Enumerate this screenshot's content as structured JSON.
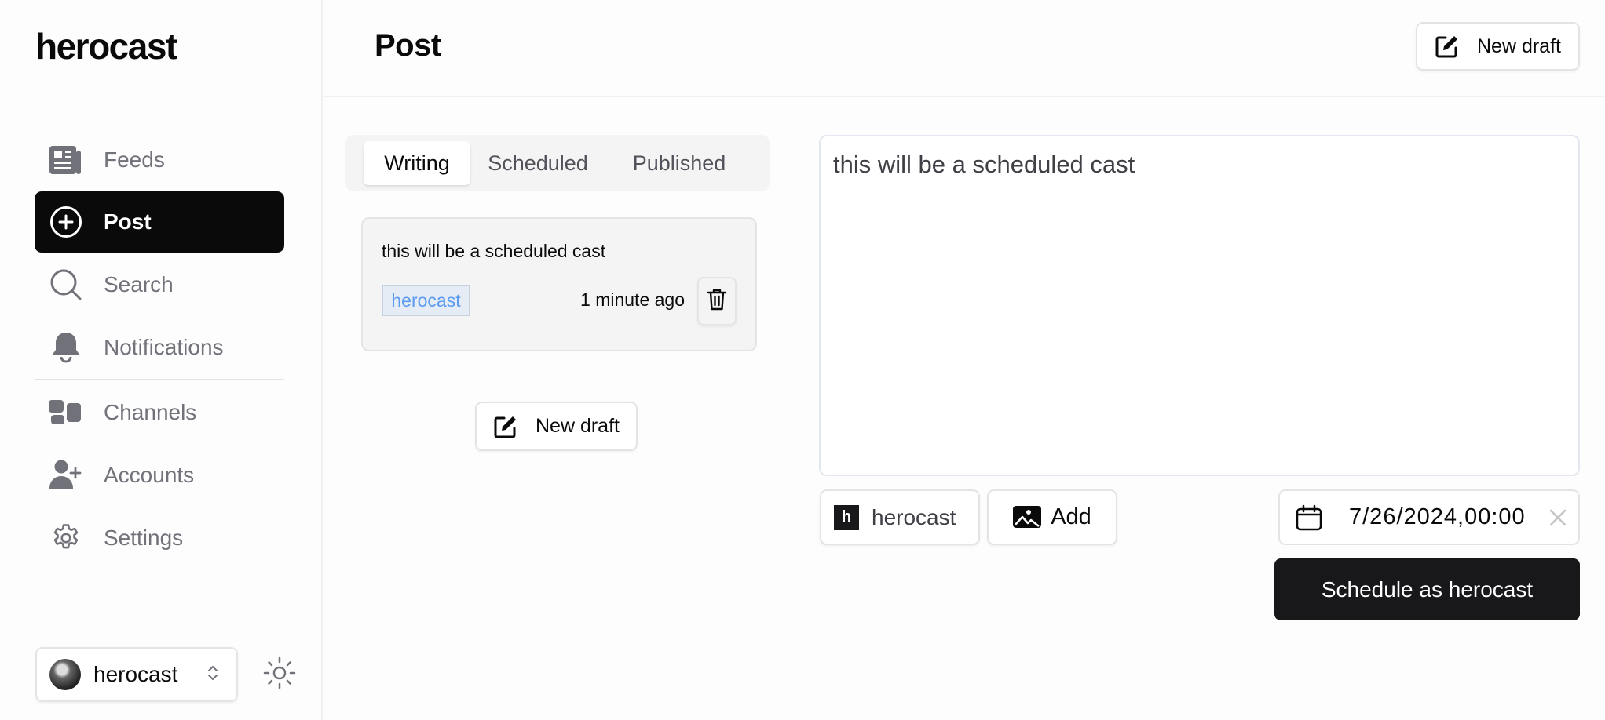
{
  "app": {
    "logo": "herocast"
  },
  "sidebar": {
    "items": [
      {
        "label": "Feeds",
        "icon": "newspaper-icon",
        "active": false
      },
      {
        "label": "Post",
        "icon": "plus-circle-icon",
        "active": true
      },
      {
        "label": "Search",
        "icon": "search-icon",
        "active": false
      },
      {
        "label": "Notifications",
        "icon": "bell-icon",
        "active": false
      },
      {
        "label": "Channels",
        "icon": "channels-icon",
        "active": false
      },
      {
        "label": "Accounts",
        "icon": "user-plus-icon",
        "active": false
      },
      {
        "label": "Settings",
        "icon": "gear-icon",
        "active": false
      }
    ],
    "account": {
      "name": "herocast"
    }
  },
  "header": {
    "title": "Post",
    "new_draft_label": "New draft"
  },
  "tabs": [
    {
      "label": "Writing",
      "active": true
    },
    {
      "label": "Scheduled",
      "active": false
    },
    {
      "label": "Published",
      "active": false
    }
  ],
  "drafts": [
    {
      "text": "this will be a scheduled cast",
      "account": "herocast",
      "time": "1 minute ago"
    }
  ],
  "drafts_new_draft_label": "New draft",
  "editor": {
    "text": "this will be a scheduled cast",
    "account_label": "herocast",
    "account_initial": "h",
    "add_label": "Add",
    "scheduled_date": "7/26/2024,00:00",
    "submit_label": "Schedule as herocast"
  },
  "colors": {
    "accent": "#0a0a0a",
    "tag_text": "#5b9bf0",
    "muted": "#71717a"
  }
}
